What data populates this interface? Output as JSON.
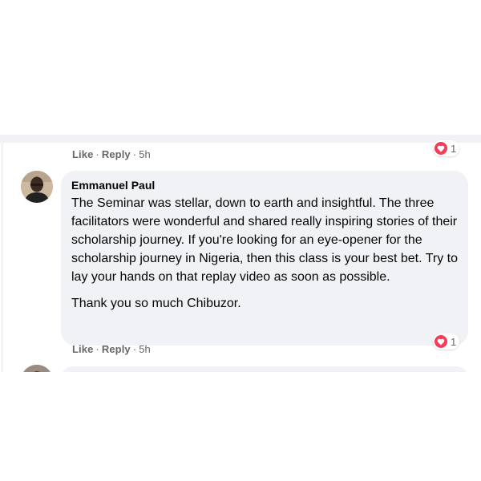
{
  "previous_comment": {
    "actions": {
      "like": "Like",
      "reply": "Reply",
      "time": "5h"
    },
    "reactions": {
      "icon": "heart-icon",
      "count": "1",
      "color": "#f33e58"
    }
  },
  "comment": {
    "author": "Emmanuel Paul",
    "paragraphs": [
      "The Seminar was stellar, down to earth and insightful. The three facilitators were wonderful and shared really inspiring stories of their scholarship journey. If you're looking for an eye-opener for the scholarship journey in Nigeria, then this class is your best bet. Try to lay your hands on that replay video as soon as possible.",
      "Thank you so much Chibuzor."
    ],
    "actions": {
      "like": "Like",
      "reply": "Reply",
      "time": "5h"
    },
    "reactions": {
      "icon": "heart-icon",
      "count": "1",
      "color": "#f33e58"
    }
  },
  "colors": {
    "bubble_bg": "#f0f2f5",
    "meta_text": "#65676b",
    "heart": "#f33e58"
  }
}
